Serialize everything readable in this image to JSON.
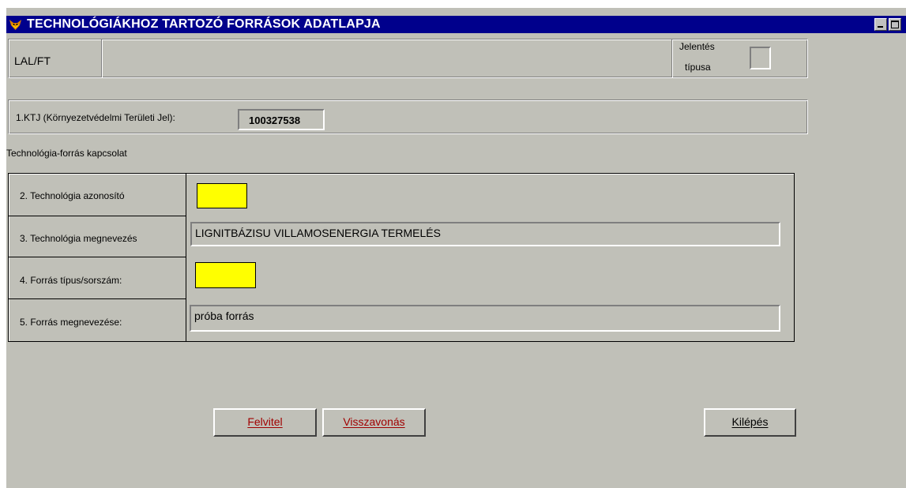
{
  "window": {
    "title": "TECHNOLÓGIÁKHOZ TARTOZÓ FORRÁSOK ADATLAPJA",
    "app_icon": "fox-icon",
    "controls": [
      "minimize-icon",
      "maximize-icon"
    ]
  },
  "header": {
    "code": "LAL/FT",
    "middle_value": "",
    "report_type_label_line1": "Jelentés",
    "report_type_label_line2": "típusa",
    "report_type_value": ""
  },
  "ktj": {
    "label": "1.KTJ (Környezetvédelmi Területi Jel):",
    "value": "100327538"
  },
  "section_title": "Technológia-forrás kapcsolat",
  "fields": [
    {
      "label": "2. Technológia azonosító",
      "value": ""
    },
    {
      "label": "3. Technológia megnevezés",
      "value": "LIGNITBÁZISU VILLAMOSENERGIA TERMELÉS"
    },
    {
      "label": "4. Forrás típus/sorszám:",
      "value": ""
    },
    {
      "label": "5. Forrás megnevezése:",
      "value": "próba forrás"
    }
  ],
  "buttons": {
    "save": "Felvitel",
    "undo": "Visszavonás",
    "exit": "Kilépés"
  },
  "colors": {
    "titlebar": "#00008c",
    "window_bg": "#c0c0b8",
    "required_field": "#ffff00",
    "button_text_accent": "#a00000"
  }
}
